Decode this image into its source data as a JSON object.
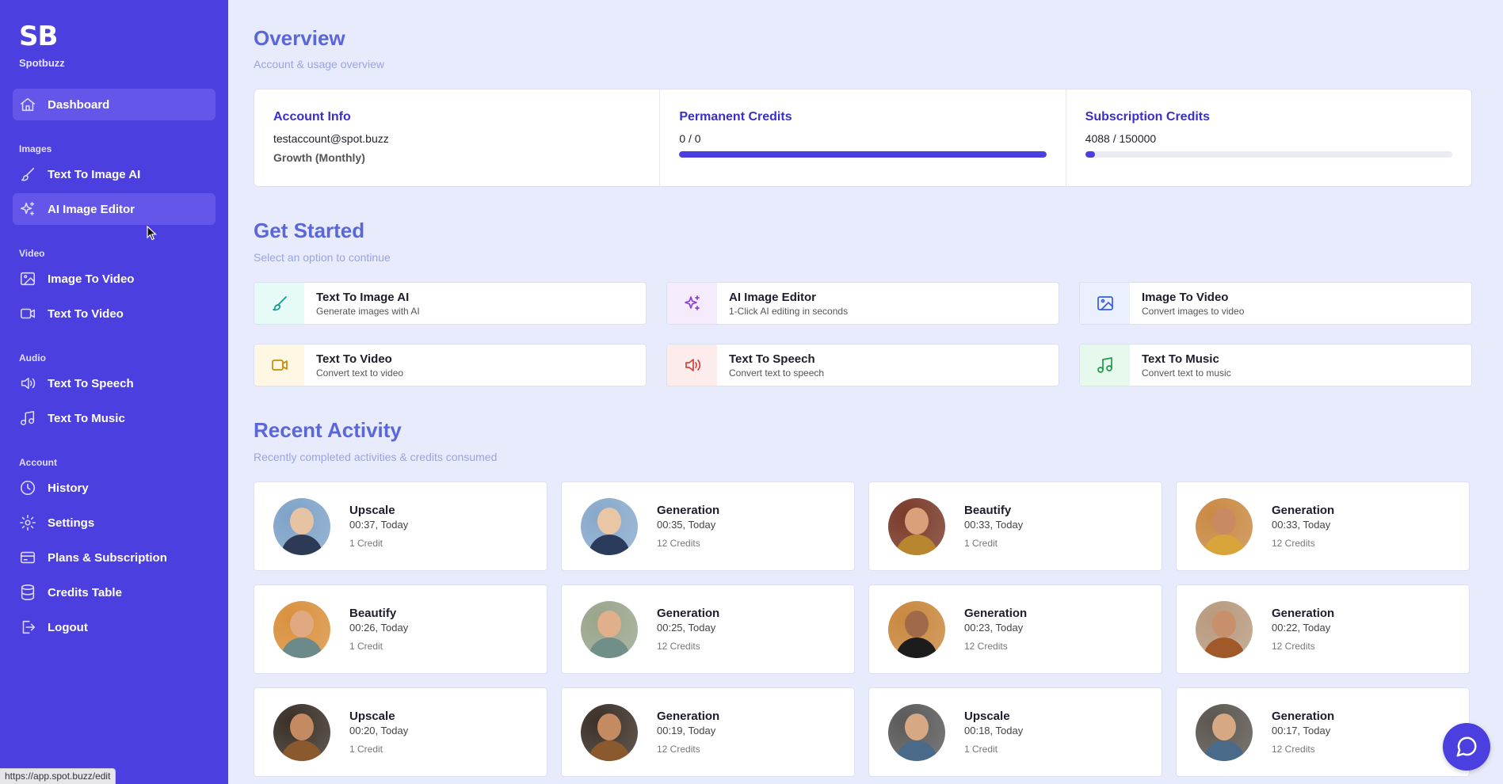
{
  "sidebar": {
    "logo": "SB",
    "brand": "Spotbuzz",
    "dashboard": "Dashboard",
    "sections": {
      "images": "Images",
      "video": "Video",
      "audio": "Audio",
      "account": "Account"
    },
    "items": {
      "text_to_image": "Text To Image AI",
      "ai_image_editor": "AI Image Editor",
      "image_to_video": "Image To Video",
      "text_to_video": "Text To Video",
      "text_to_speech": "Text To Speech",
      "text_to_music": "Text To Music",
      "history": "History",
      "settings": "Settings",
      "plans": "Plans & Subscription",
      "credits_table": "Credits Table",
      "logout": "Logout"
    }
  },
  "status_bar": {
    "url": "https://app.spot.buzz/edit"
  },
  "overview": {
    "title": "Overview",
    "subtitle": "Account & usage overview",
    "account": {
      "title": "Account Info",
      "email": "testaccount@spot.buzz",
      "plan": "Growth (Monthly)"
    },
    "permanent": {
      "title": "Permanent Credits",
      "value": "0 / 0",
      "fill_percent": 100
    },
    "subscription": {
      "title": "Subscription Credits",
      "value": "4088 / 150000",
      "fill_percent": 2.7
    }
  },
  "get_started": {
    "title": "Get Started",
    "subtitle": "Select an option to continue",
    "options": [
      {
        "title": "Text To Image AI",
        "desc": "Generate images with AI",
        "icon": "brush-icon",
        "color": "#0f9b8e",
        "bg": "#e6faf7"
      },
      {
        "title": "AI Image Editor",
        "desc": "1-Click AI editing in seconds",
        "icon": "sparkles-icon",
        "color": "#8b3fd9",
        "bg": "#f4ecfd"
      },
      {
        "title": "Image To Video",
        "desc": "Convert images to video",
        "icon": "image-icon",
        "color": "#3a5bd9",
        "bg": "#eaf0fd"
      },
      {
        "title": "Text To Video",
        "desc": "Convert text to video",
        "icon": "video-icon",
        "color": "#c98a0a",
        "bg": "#fdf7e3"
      },
      {
        "title": "Text To Speech",
        "desc": "Convert text to speech",
        "icon": "speaker-icon",
        "color": "#d1433a",
        "bg": "#fdecec"
      },
      {
        "title": "Text To Music",
        "desc": "Convert text to music",
        "icon": "music-icon",
        "color": "#1e9a4a",
        "bg": "#e7f8ec"
      }
    ]
  },
  "recent": {
    "title": "Recent Activity",
    "subtitle": "Recently completed activities & credits consumed",
    "items": [
      {
        "name": "Upscale",
        "time": "00:37, Today",
        "credits": "1 Credit",
        "bg": "#7fa3c8",
        "skin": "#e6c3a3",
        "cloth": "#2c3a55"
      },
      {
        "name": "Generation",
        "time": "00:35, Today",
        "credits": "12 Credits",
        "bg": "#88a9cc",
        "skin": "#e8c6a6",
        "cloth": "#2a3b5c"
      },
      {
        "name": "Beautify",
        "time": "00:33, Today",
        "credits": "1 Credit",
        "bg": "#7a3b2a",
        "skin": "#d9a07a",
        "cloth": "#b8862e"
      },
      {
        "name": "Generation",
        "time": "00:33, Today",
        "credits": "12 Credits",
        "bg": "#c98a44",
        "skin": "#c98a63",
        "cloth": "#d9a43a"
      },
      {
        "name": "Beautify",
        "time": "00:26, Today",
        "credits": "1 Credit",
        "bg": "#d9913e",
        "skin": "#e0a982",
        "cloth": "#6d8a8a"
      },
      {
        "name": "Generation",
        "time": "00:25, Today",
        "credits": "12 Credits",
        "bg": "#9aa58c",
        "skin": "#e0b08c",
        "cloth": "#6f8f88"
      },
      {
        "name": "Generation",
        "time": "00:23, Today",
        "credits": "12 Credits",
        "bg": "#c9883e",
        "skin": "#a06a4a",
        "cloth": "#1c1c1c"
      },
      {
        "name": "Generation",
        "time": "00:22, Today",
        "credits": "12 Credits",
        "bg": "#b89a7e",
        "skin": "#c8906a",
        "cloth": "#a05a2a"
      },
      {
        "name": "Upscale",
        "time": "00:20, Today",
        "credits": "1 Credit",
        "bg": "#3a3028",
        "skin": "#c48a62",
        "cloth": "#8a5a2e"
      },
      {
        "name": "Generation",
        "time": "00:19, Today",
        "credits": "12 Credits",
        "bg": "#3c3128",
        "skin": "#c48a62",
        "cloth": "#8a5a2e"
      },
      {
        "name": "Upscale",
        "time": "00:18, Today",
        "credits": "1 Credit",
        "bg": "#5a5a5a",
        "skin": "#d6a884",
        "cloth": "#4a6a8a"
      },
      {
        "name": "Generation",
        "time": "00:17, Today",
        "credits": "12 Credits",
        "bg": "#5c5650",
        "skin": "#d6a884",
        "cloth": "#4a6a8a"
      }
    ]
  },
  "chat_button_icon": "chat-icon"
}
